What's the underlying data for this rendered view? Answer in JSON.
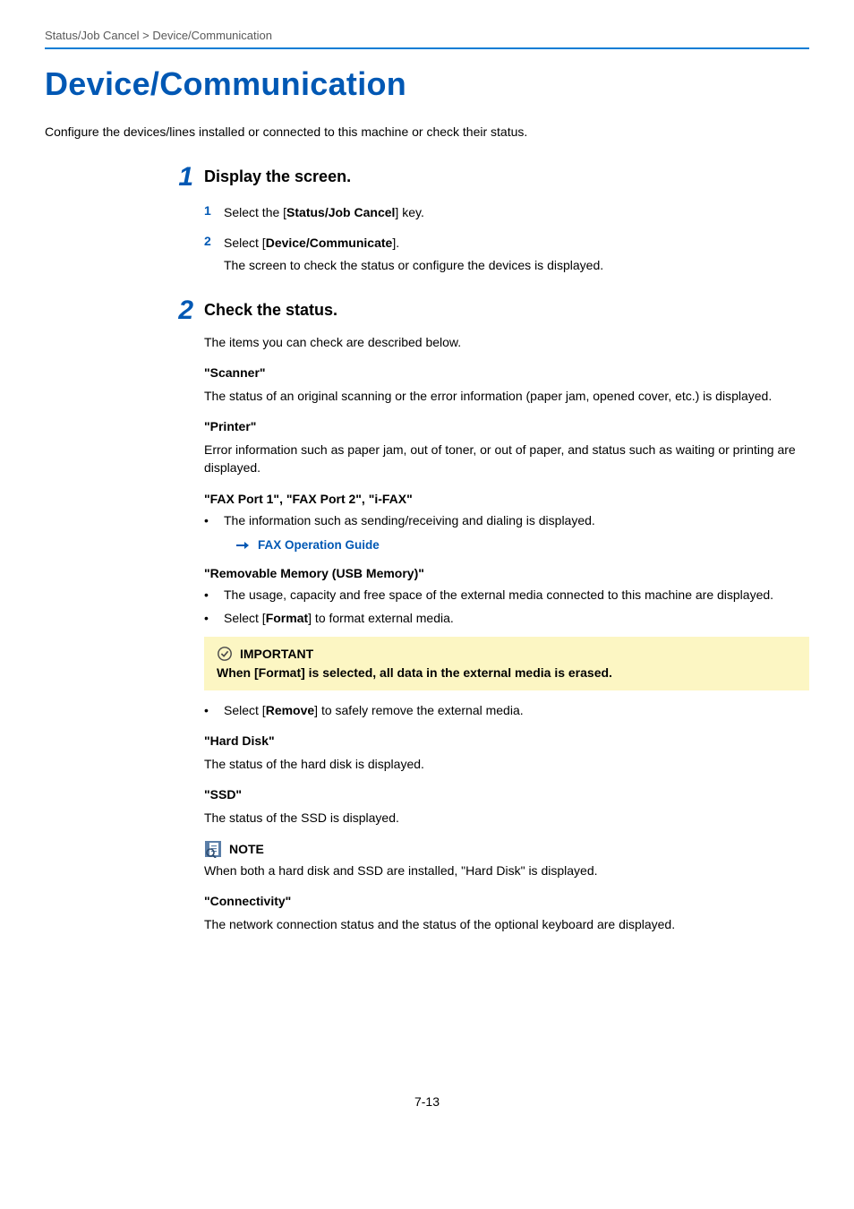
{
  "breadcrumb": "Status/Job Cancel > Device/Communication",
  "title": "Device/Communication",
  "intro": "Configure the devices/lines installed or connected to this machine or check their status.",
  "step1": {
    "num": "1",
    "title": "Display the screen.",
    "sub1": {
      "num": "1",
      "pre": "Select the [",
      "bold": "Status/Job Cancel",
      "post": "] key."
    },
    "sub2": {
      "num": "2",
      "pre": "Select [",
      "bold": "Device/Communicate",
      "post": "]."
    },
    "follow": "The screen to check the status or configure the devices is displayed."
  },
  "step2": {
    "num": "2",
    "title": "Check the status.",
    "intro": "The items you can check are described below.",
    "scanner": {
      "head": "\"Scanner\"",
      "body": "The status of an original scanning or the error information (paper jam, opened cover, etc.) is displayed."
    },
    "printer": {
      "head": "\"Printer\"",
      "body": "Error information such as paper jam, out of toner, or out of paper, and status such as waiting or printing are displayed."
    },
    "fax": {
      "head": "\"FAX Port 1\", \"FAX Port 2\", \"i-FAX\"",
      "bullet": "The information such as sending/receiving and dialing is displayed.",
      "link": "FAX Operation Guide"
    },
    "removable": {
      "head": "\"Removable Memory (USB Memory)\"",
      "bullet1": "The usage, capacity and free space of the external media connected to this machine are displayed.",
      "bullet2_pre": "Select [",
      "bullet2_bold": "Format",
      "bullet2_post": "] to format external media.",
      "important_label": "IMPORTANT",
      "important_body": "When [Format] is selected, all data in the external media is erased.",
      "bullet3_pre": "Select [",
      "bullet3_bold": "Remove",
      "bullet3_post": "] to safely remove the external media."
    },
    "hdd": {
      "head": "\"Hard Disk\"",
      "body": "The status of the hard disk is displayed."
    },
    "ssd": {
      "head": "\"SSD\"",
      "body": "The status of the SSD is displayed."
    },
    "note": {
      "label": "NOTE",
      "body": "When both a hard disk and SSD are installed, \"Hard Disk\" is displayed."
    },
    "connectivity": {
      "head": "\"Connectivity\"",
      "body": "The network connection status and the status of the optional keyboard are displayed."
    }
  },
  "page_number": "7-13"
}
